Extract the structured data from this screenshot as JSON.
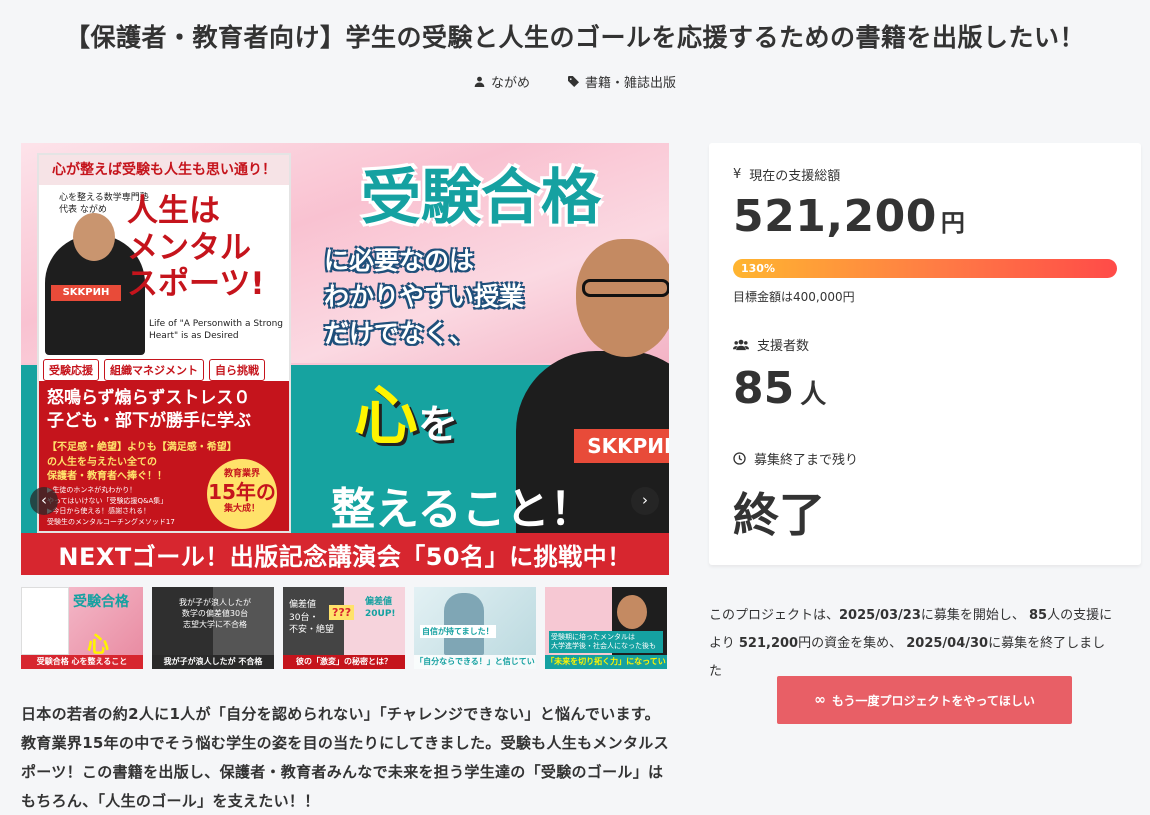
{
  "page": {
    "title": "【保護者・教育者向け】学生の受験と人生のゴールを応援するための書籍を出版したい！"
  },
  "meta": {
    "author": "ながめ",
    "category": "書籍・雑誌出版"
  },
  "hero": {
    "book_header": "心が整えば受験も人生も思い通り！",
    "book_author": "心を整える数学専門塾\n代表 ながめ",
    "book_title": "人生は\nメンタル\nスポーツ!",
    "book_subtitle": "Life of \"A Personwith a Strong\nHeart\" is as Desired",
    "book_logo": "SKKPИH",
    "tags": [
      "受験応援",
      "組織マネジメント",
      "自ら挑戦"
    ],
    "book_lead": "怒鳴らず煽らずストレス０\n子ども・部下が勝手に学ぶ",
    "book_lead2": "【不足感・絶望】よりも【満足感・希望】\nの人生を与えたい全ての\n保護者・教育者へ捧ぐ！！",
    "book_points": "▶生徒のホンネが丸わかり！\nやってはいけない「受験応援Q&A集」\n▶今日から使える！感謝される！\n受験生のメンタルコーチングメソッド17",
    "badge_top": "教育業界",
    "badge_main": "15年の",
    "badge_bottom": "集大成！",
    "catch_main": "受験合格",
    "catch_sub": "に必要なのは\nわかりやすい授業\nだけでなく、",
    "catch_heart": "心",
    "catch_wo": "を",
    "catch_end": "整えること！",
    "shirt_logo": "SKKPИH",
    "banner": "NEXTゴール！出版記念講演会「50名」に挑戦中！"
  },
  "thumbs": [
    {
      "caption": "受験合格 心を整えること",
      "color": "#f2a7b8"
    },
    {
      "caption": "我が子が浪人したが 不合格",
      "color": "#3b3b3b"
    },
    {
      "caption": "彼の「激変」の秘密とは？",
      "color": "#1e1e1e"
    },
    {
      "caption": "「自分ならできる！」と信じています",
      "color": "#d9ecf0"
    },
    {
      "caption": "「未来を切り拓く力」になっている！",
      "color": "#f3c3cf"
    }
  ],
  "description": "日本の若者の約2人に1人が「自分を認められない」「チャレンジできない」と悩んでいます。教育業界15年の中でそう悩む学生の姿を目の当たりにしてきました。受験も人生もメンタルスポーツ！この書籍を出版し、保護者・教育者みんなで未来を担う学生達の「受験のゴール」はもちろん、「人生のゴール」を支えたい！！",
  "stats": {
    "total_label": "現在の支援総額",
    "total_amount": "521,200",
    "total_unit": "円",
    "progress_percent": 130,
    "progress_label": "130%",
    "goal_text": "目標金額は400,000円",
    "supporters_label": "支援者数",
    "supporters_count": "85",
    "supporters_unit": "人",
    "remaining_label": "募集終了まで残り",
    "remaining_value": "終了"
  },
  "summary": {
    "p1": "このプロジェクトは、",
    "start_date": "2025/03/23",
    "p2": "に募集を開始し、 ",
    "count": "85",
    "p3": "人の支援により ",
    "amount": "521,200",
    "p4": "円の資金を集め、 ",
    "end_date": "2025/04/30",
    "p5": "に募集を終了しました"
  },
  "cta": {
    "icon": "∞",
    "label": "もう一度プロジェクトをやってほしい"
  }
}
